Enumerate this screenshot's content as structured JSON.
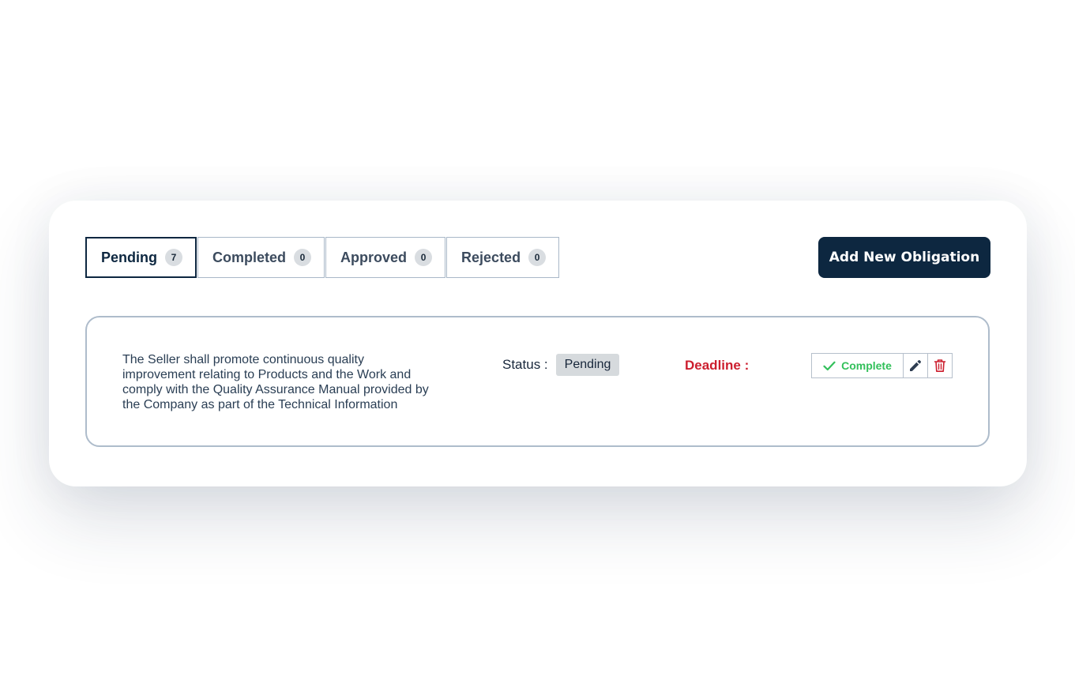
{
  "tabs": [
    {
      "label": "Pending",
      "count": "7"
    },
    {
      "label": "Completed",
      "count": "0"
    },
    {
      "label": "Approved",
      "count": "0"
    },
    {
      "label": "Rejected",
      "count": "0"
    }
  ],
  "add_button_label": "Add New Obligation",
  "obligation": {
    "text": "The Seller shall promote continuous quality improvement relating to Products and the Work and comply with the Quality Assurance Manual provided by the Company as part of the Technical Information",
    "status_label": "Status :",
    "status_value": "Pending",
    "deadline_label": "Deadline :",
    "complete_label": "Complete"
  },
  "icons": {
    "complete": "check-icon",
    "edit": "pencil-icon",
    "delete": "trash-icon"
  },
  "colors": {
    "primary": "#0d2740",
    "success": "#33c05b",
    "danger": "#cc1e2e"
  }
}
